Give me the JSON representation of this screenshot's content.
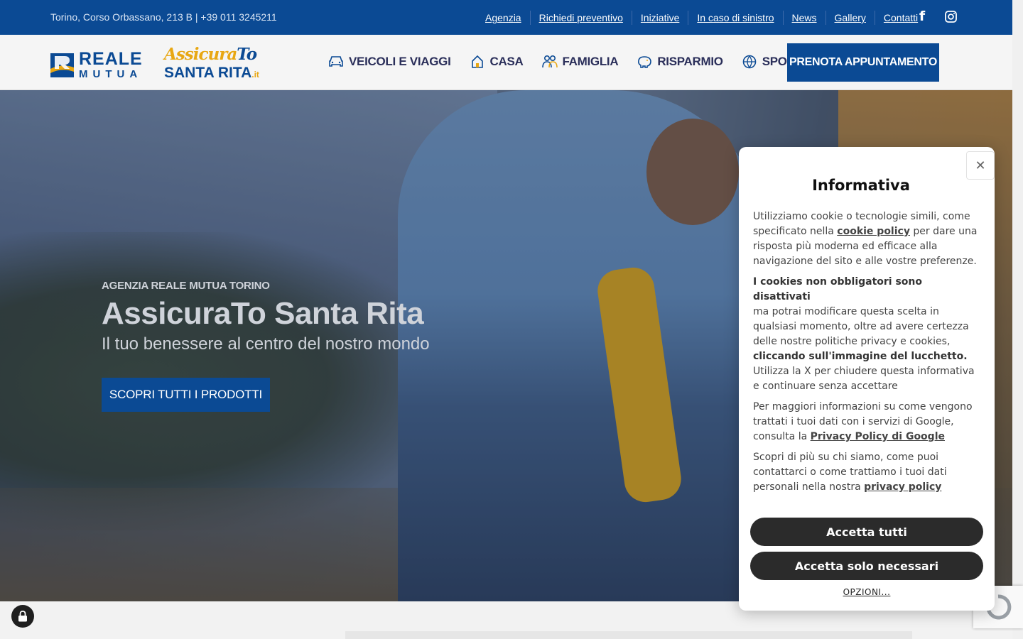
{
  "topbar": {
    "address": "Torino, Corso Orbassano, 213 B | +39 011 3245211",
    "links": [
      "Agenzia",
      "Richiedi preventivo",
      "Iniziative",
      "In caso di sinistro",
      "News",
      "Gallery",
      "Contatti"
    ],
    "social": [
      "facebook-icon",
      "instagram-icon"
    ]
  },
  "header": {
    "logo_reale_line1": "REALE",
    "logo_reale_line2": "MUTUA",
    "logo_santa_line1a": "Assicura",
    "logo_santa_line1b": "To",
    "logo_santa_line2a": "SANTA RITA",
    "logo_santa_line2b": ".it",
    "nav": [
      {
        "label": "VEICOLI E VIAGGI",
        "icon": "car-icon"
      },
      {
        "label": "CASA",
        "icon": "house-icon"
      },
      {
        "label": "FAMIGLIA",
        "icon": "family-icon"
      },
      {
        "label": "RISPARMIO",
        "icon": "piggy-bank-icon"
      },
      {
        "label": "SPORT",
        "icon": "ball-icon"
      }
    ],
    "cta": "PRENOTA APPUNTAMENTO"
  },
  "hero": {
    "kicker": "AGENZIA REALE MUTUA TORINO",
    "title": "AssicuraTo Santa Rita",
    "subtitle": "Il tuo benessere al centro del nostro mondo",
    "button": "SCOPRI TUTTI I PRODOTTI"
  },
  "cookie": {
    "title": "Informativa",
    "p1_a": "Utilizziamo cookie o tecnologie simili, come specificato nella ",
    "p1_link": "cookie policy",
    "p1_b": "  per dare una risposta più moderna ed efficace alla navigazione del sito e alle vostre preferenze.",
    "p2_bold": "I cookies non obbligatori sono disattivati",
    "p2_a": "ma potrai modificare questa scelta in qualsiasi momento, oltre ad avere certezza delle nostre politiche privacy e cookies,",
    "p2_bold2": "cliccando sull'immagine del lucchetto.",
    "p2_b": "Utilizza la X per chiudere questa informativa e continuare senza accettare",
    "p3_a": "Per maggiori informazioni su come vengono trattati i tuoi dati con i servizi di Google, consulta la ",
    "p3_link": "Privacy Policy di Google",
    "p4_a": "Scopri di più su chi siamo, come puoi contattarci o come trattiamo i tuoi dati personali nella nostra ",
    "p4_link": "privacy policy",
    "accept_all": "Accetta tutti",
    "accept_necessary": "Accetta solo necessari",
    "options": "OPZIONI...",
    "close_glyph": "✕"
  },
  "colors": {
    "brand_blue": "#0b4a94",
    "gold": "#e8a713",
    "dark_button": "#2b2b2b"
  }
}
